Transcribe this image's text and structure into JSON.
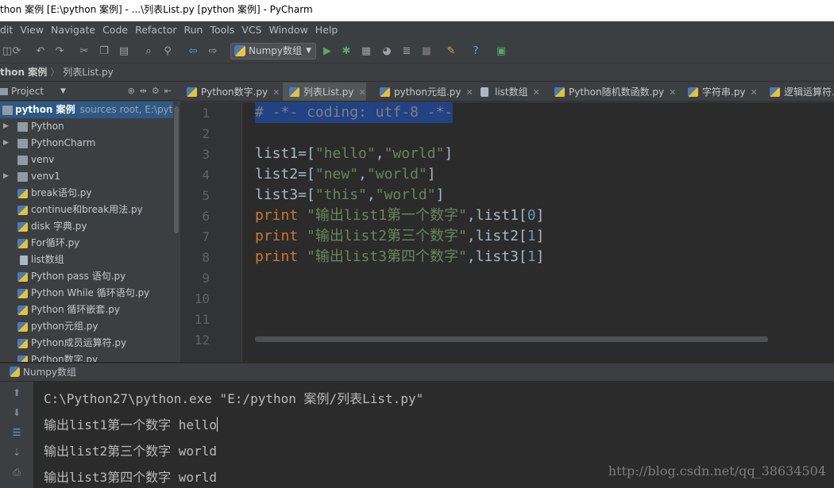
{
  "window": {
    "title": "thon 案例 [E:\\python 案例] - ...\\列表List.py [python 案例] - PyCharm"
  },
  "menu": [
    "dit",
    "View",
    "Navigate",
    "Code",
    "Refactor",
    "Run",
    "Tools",
    "VCS",
    "Window",
    "Help"
  ],
  "toolbar": {
    "run_config": "Numpy数组",
    "icons": [
      "sync-icon",
      "undo-icon",
      "redo-icon",
      "cut-icon",
      "copy-icon",
      "paste-icon",
      "find-icon",
      "replace-icon",
      "back-icon",
      "forward-icon",
      "run-icon",
      "debug-icon",
      "coverage-icon",
      "profile-icon",
      "concurrency-icon",
      "stop-icon",
      "settings-icon",
      "help-icon",
      "sdk-icon"
    ]
  },
  "navbar": {
    "project": "thon 案例",
    "file": "列表List.py"
  },
  "project_panel": {
    "title": "Project",
    "root": {
      "name": "python 案例",
      "detail": "sources root,  E:\\pytho"
    },
    "items": [
      {
        "label": "Python",
        "type": "folder",
        "expandable": true
      },
      {
        "label": "PythonCharm",
        "type": "folder",
        "expandable": true
      },
      {
        "label": "venv",
        "type": "folder",
        "expandable": false
      },
      {
        "label": "venv1",
        "type": "folder",
        "expandable": true
      },
      {
        "label": "break语句.py",
        "type": "file"
      },
      {
        "label": "continue和break用法.py",
        "type": "file"
      },
      {
        "label": "disk 字典.py",
        "type": "file"
      },
      {
        "label": "For循环.py",
        "type": "file"
      },
      {
        "label": "list数组",
        "type": "doc"
      },
      {
        "label": "Python pass 语句.py",
        "type": "file"
      },
      {
        "label": "Python While 循环语句.py",
        "type": "file"
      },
      {
        "label": "Python 循环嵌套.py",
        "type": "file"
      },
      {
        "label": "python元组.py",
        "type": "file"
      },
      {
        "label": "Python成员运算符.py",
        "type": "file"
      },
      {
        "label": "Python数字.py",
        "type": "file"
      }
    ]
  },
  "tabs": [
    {
      "label": "Python数字.py",
      "active": false,
      "icon": "python"
    },
    {
      "label": "列表List.py",
      "active": true,
      "icon": "python"
    },
    {
      "label": "python元组.py",
      "active": false,
      "icon": "python"
    },
    {
      "label": "list数组",
      "active": false,
      "icon": "doc"
    },
    {
      "label": "Python随机数函数.py",
      "active": false,
      "icon": "python"
    },
    {
      "label": "字符串.py",
      "active": false,
      "icon": "python"
    },
    {
      "label": "逻辑运算符.py",
      "active": false,
      "icon": "python"
    }
  ],
  "editor": {
    "line_numbers": [
      "1",
      "2",
      "3",
      "4",
      "5",
      "6",
      "7",
      "8",
      "9",
      "10",
      "11",
      "12"
    ],
    "lines": [
      [
        {
          "t": "cmt",
          "v": "# -*- coding: utf-8 -*-"
        }
      ],
      [],
      [
        {
          "t": "id",
          "v": "list1=["
        },
        {
          "t": "str",
          "v": "\"hello\""
        },
        {
          "t": "id",
          "v": ","
        },
        {
          "t": "str",
          "v": "\"world\""
        },
        {
          "t": "id",
          "v": "]"
        }
      ],
      [
        {
          "t": "id",
          "v": "list2=["
        },
        {
          "t": "str",
          "v": "\"new\""
        },
        {
          "t": "id",
          "v": ","
        },
        {
          "t": "str",
          "v": "\"world\""
        },
        {
          "t": "id",
          "v": "]"
        }
      ],
      [
        {
          "t": "id",
          "v": "list3=["
        },
        {
          "t": "str",
          "v": "\"this\""
        },
        {
          "t": "id",
          "v": ","
        },
        {
          "t": "str",
          "v": "\"world\""
        },
        {
          "t": "id",
          "v": "]"
        }
      ],
      [
        {
          "t": "kw",
          "v": "print "
        },
        {
          "t": "str",
          "v": "\"输出list1第一个数字\""
        },
        {
          "t": "id",
          "v": ",list1["
        },
        {
          "t": "num",
          "v": "0"
        },
        {
          "t": "id",
          "v": "]"
        }
      ],
      [
        {
          "t": "kw",
          "v": "print "
        },
        {
          "t": "str",
          "v": "\"输出list2第三个数字\""
        },
        {
          "t": "id",
          "v": ",list2["
        },
        {
          "t": "num",
          "v": "1"
        },
        {
          "t": "id",
          "v": "]"
        }
      ],
      [
        {
          "t": "kw",
          "v": "print "
        },
        {
          "t": "str",
          "v": "\"输出list3第四个数字\""
        },
        {
          "t": "id",
          "v": ",list3["
        },
        {
          "t": "num",
          "v": "1"
        },
        {
          "t": "id",
          "v": "]"
        }
      ]
    ]
  },
  "run_panel": {
    "title": "Numpy数组",
    "output": [
      "C:\\Python27\\python.exe \"E:/python 案例/列表List.py\"",
      "输出list1第一个数字 hello",
      "输出list2第三个数字 world",
      "输出list3第四个数字 world"
    ]
  },
  "watermark": "http://blog.csdn.net/qq_38634504"
}
